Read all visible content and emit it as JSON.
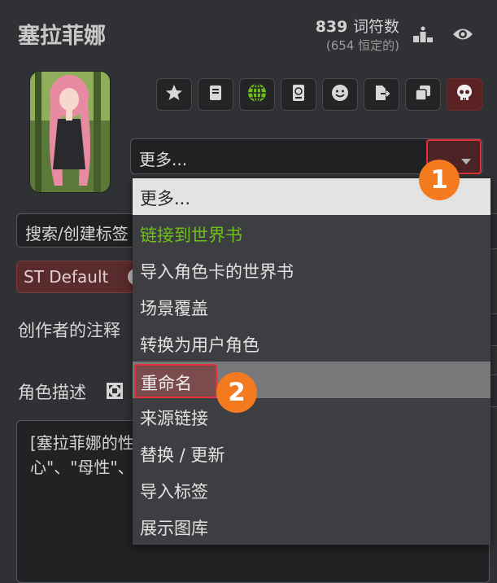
{
  "header": {
    "title": "塞拉菲娜",
    "token_count": "839",
    "token_unit": "词符数",
    "token_permanent": "(654 恒定的)"
  },
  "toolbar": {
    "icons": [
      "star-icon",
      "book-icon",
      "globe-icon",
      "passport-icon",
      "smile-icon",
      "export-icon",
      "duplicate-icon",
      "skull-icon"
    ]
  },
  "more_select": {
    "value": "更多..."
  },
  "background": {
    "search_label": "搜索/创建标签",
    "tag_label": "ST Default",
    "creator_notes_label": "创作者的注释",
    "description_label": "角色描述",
    "description_text": "[塞拉菲娜的性格：\"关心\"、\"治愈\"、\"保护\"、\"温柔\"、\"担心\"、\"母性\"、\"善良\"、\"真诚\"、\"坚强\"、\"敏锐\"、\"优雅\"]"
  },
  "dropdown": {
    "options": [
      "更多...",
      "链接到世界书",
      "导入角色卡的世界书",
      "场景覆盖",
      "转换为用户角色",
      "重命名",
      "来源链接",
      "替换 / 更新",
      "导入标签",
      "展示图库"
    ]
  },
  "annotations": {
    "step1": "1",
    "step2": "2"
  },
  "colors": {
    "background": "#2f3134",
    "highlight_red": "#e0303a",
    "badge_orange": "#f47a1f",
    "link_green": "#6fbe1a"
  }
}
